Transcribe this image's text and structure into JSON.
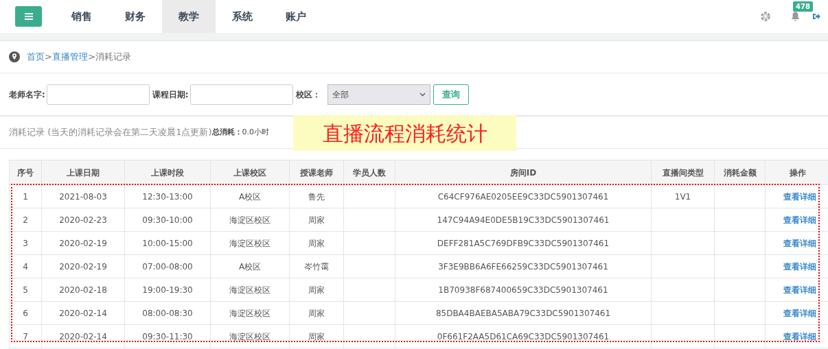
{
  "nav": {
    "tabs": [
      {
        "label": "销售",
        "selected": false
      },
      {
        "label": "财务",
        "selected": false
      },
      {
        "label": "教学",
        "selected": true
      },
      {
        "label": "系统",
        "selected": false
      },
      {
        "label": "账户",
        "selected": false
      }
    ],
    "notification_count": "478"
  },
  "breadcrumb": {
    "links": [
      "首页",
      "直播管理"
    ],
    "separator": ">",
    "current": "消耗记录"
  },
  "filters": {
    "teacher_label": "老师名字:",
    "date_label": "课程日期:",
    "campus_label": "校区：",
    "campus_value": "全部",
    "search_button": "查询"
  },
  "summary": {
    "note": "消耗记录 (当天的消耗记录会在第二天凌晨1点更新)",
    "total_label": "总消耗：",
    "total_value": "0.0小时"
  },
  "annotation": "直播流程消耗统计",
  "table": {
    "columns": [
      "序号",
      "上课日期",
      "上课时段",
      "上课校区",
      "授课老师",
      "学员人数",
      "房间ID",
      "直播间类型",
      "消耗金额",
      "操作"
    ],
    "rows": [
      {
        "no": "1",
        "date": "2021-08-03",
        "time": "12:30-13:00",
        "campus": "A校区",
        "teacher": "鲁先",
        "room_id": "C64CF976AE0205EE9C33DC5901307461",
        "room_type": "1V1",
        "action": "查看详细"
      },
      {
        "no": "2",
        "date": "2020-02-23",
        "time": "09:30-10:00",
        "campus": "海淀区校区",
        "teacher": "周家",
        "room_id": "147C94A94E0DE5B19C33DC5901307461",
        "action": "查看详细"
      },
      {
        "no": "3",
        "date": "2020-02-19",
        "time": "10:00-15:00",
        "campus": "海淀区校区",
        "teacher": "周家",
        "room_id": "DEFF281A5C769DFB9C33DC5901307461",
        "action": "查看详细"
      },
      {
        "no": "4",
        "date": "2020-02-19",
        "time": "07:00-08:00",
        "campus": "A校区",
        "teacher": "岑竹霭",
        "room_id": "3F3E9BB6A6FE66259C33DC5901307461",
        "action": "查看详细"
      },
      {
        "no": "5",
        "date": "2020-02-18",
        "time": "19:00-19:30",
        "campus": "海淀区校区",
        "teacher": "周家",
        "room_id": "1B70938F687400659C33DC5901307461",
        "action": "查看详细"
      },
      {
        "no": "6",
        "date": "2020-02-14",
        "time": "08:00-08:30",
        "campus": "海淀区校区",
        "teacher": "周家",
        "room_id": "85DBA4BAEBA5ABA79C33DC5901307461",
        "action": "查看详细"
      },
      {
        "no": "7",
        "date": "2020-02-14",
        "time": "09:30-11:30",
        "campus": "海淀区校区",
        "teacher": "周家",
        "room_id": "0F661F2AA5D61CA69C33DC5901307461",
        "action": "查看详细"
      }
    ]
  }
}
